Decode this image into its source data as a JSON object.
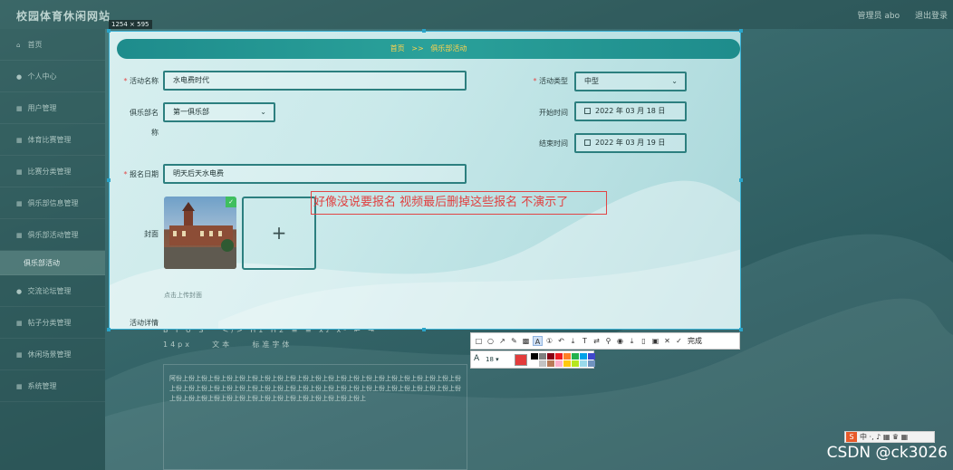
{
  "app": {
    "title": "校园体育休闲网站",
    "top_right": {
      "user": "管理员 abo",
      "logout": "退出登录"
    }
  },
  "sidebar": {
    "items": [
      {
        "label": "首页",
        "icon": "home-icon"
      },
      {
        "label": "个人中心",
        "icon": "person-icon"
      },
      {
        "label": "用户管理",
        "icon": "grid-icon"
      },
      {
        "label": "体育比赛管理",
        "icon": "grid-icon"
      },
      {
        "label": "比赛分类管理",
        "icon": "grid-icon"
      },
      {
        "label": "俱乐部信息管理",
        "icon": "grid-icon"
      },
      {
        "label": "俱乐部活动管理",
        "icon": "grid-icon"
      },
      {
        "label": "俱乐部活动",
        "icon": "",
        "active": true
      },
      {
        "label": "交流论坛管理",
        "icon": "person-icon"
      },
      {
        "label": "帖子分类管理",
        "icon": "grid-icon"
      },
      {
        "label": "休闲场景管理",
        "icon": "grid-icon"
      },
      {
        "label": "系统管理",
        "icon": "grid-icon"
      }
    ]
  },
  "capture": {
    "size_label": "1254 × 595"
  },
  "breadcrumb": {
    "home": "首页",
    "separator": ">>",
    "current": "俱乐部活动"
  },
  "form": {
    "activity_name": {
      "label": "活动名称",
      "value": "水电费时代",
      "required": true
    },
    "activity_type": {
      "label": "活动类型",
      "value": "中型",
      "required": true
    },
    "club_name": {
      "label": "俱乐部名",
      "label_wrap": "称",
      "value": "第一俱乐部"
    },
    "start_time": {
      "label": "开始时间",
      "value": "2022 年 03 月 18 日"
    },
    "end_time": {
      "label": "结束时间",
      "value": "2022 年 03 月 19 日"
    },
    "signup_date": {
      "label": "报名日期",
      "value": "明天后天水电费",
      "required": true
    },
    "cover": {
      "label": "封面",
      "hint": "点击上传封面"
    },
    "details": {
      "label": "活动详情"
    }
  },
  "annotation": {
    "text": "好像没说要报名  视频最后删掉这些报名 不演示了"
  },
  "editor_behind": {
    "toolbar_row1": "B I U S “ </> H1 H2 ≡ ≡ x₂ x² ⇤ ⇥",
    "toolbar_row2_size": "14px",
    "toolbar_row2_font": "文本",
    "toolbar_row2_family": "标准字体",
    "content": "阿份上份上份上份上份上份上份上份上份上份上份上份上份上份上份上份上份上份上份上份上份上份上份上份上份上份上份上份上份上份上份上份上份上份上份上份上份上份上份上份上份上份上份上份上份上份上份上份上份上份上份上份上份上份上份上份上份上份上份上份上份上"
  },
  "tool": {
    "font_size": "18",
    "done_label": "完成",
    "current_color": "#e33b3b",
    "palette": [
      "#000000",
      "#7f7f7f",
      "#880015",
      "#ed1c24",
      "#ff7f27",
      "#22b14c",
      "#00a2e8",
      "#3f48cc",
      "#ffffff",
      "#c3c3c3",
      "#b97a57",
      "#ffaec9",
      "#ffc90e",
      "#b5e61d",
      "#99d9ea",
      "#7092be"
    ]
  },
  "ime": {
    "logo": "S",
    "label": "中 ·, ♪ ▦ ♛ ▦"
  },
  "watermark": "CSDN @ck3026"
}
